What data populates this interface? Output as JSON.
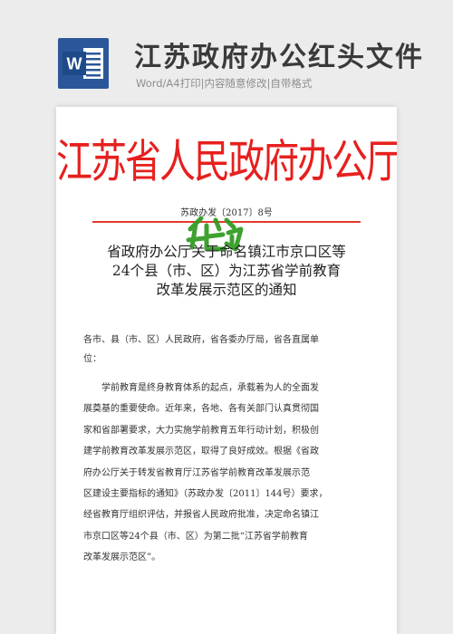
{
  "header": {
    "app_icon": "word-icon",
    "app_icon_letter": "W",
    "title": "江苏政府办公红头文件",
    "subtitle": "Word/A4打印|内容随意修改|自带格式"
  },
  "document": {
    "red_title": "江苏省人民政府办公厅文件",
    "doc_number": "苏政办发〔2017〕8号",
    "stamp_icon": "green-stamp-icon",
    "notice_title": [
      "省政府办公厅关于命名镇江市京口区等",
      "24个县（市、区）为江苏省学前教育",
      "改革发展示范区的通知"
    ],
    "salutation": [
      "各市、县（市、区）人民政府，省各委办厅局，省各直属单",
      "位："
    ],
    "body_lines": [
      "学前教育是终身教育体系的起点，承载着为人的全面发",
      "展奠基的重要使命。近年来，各地、各有关部门认真贯彻国",
      "家和省部署要求，大力实施学前教育五年行动计划，积极创",
      "建学前教育改革发展示范区，取得了良好成效。根据《省政",
      "府办公厅关于转发省教育厅江苏省学前教育改革发展示范",
      "区建设主要指标的通知》（苏政办发〔2011〕144号）要求，",
      "经省教育厅组织评估，并报省人民政府批准，决定命名镇江",
      "市京口区等24个县（市、区）为第二批“江苏省学前教育",
      "改革发展示范区”。"
    ]
  },
  "colors": {
    "red_header": "#e6201e",
    "word_blue": "#2b579a",
    "stamp_green": "#2e9a1e"
  }
}
